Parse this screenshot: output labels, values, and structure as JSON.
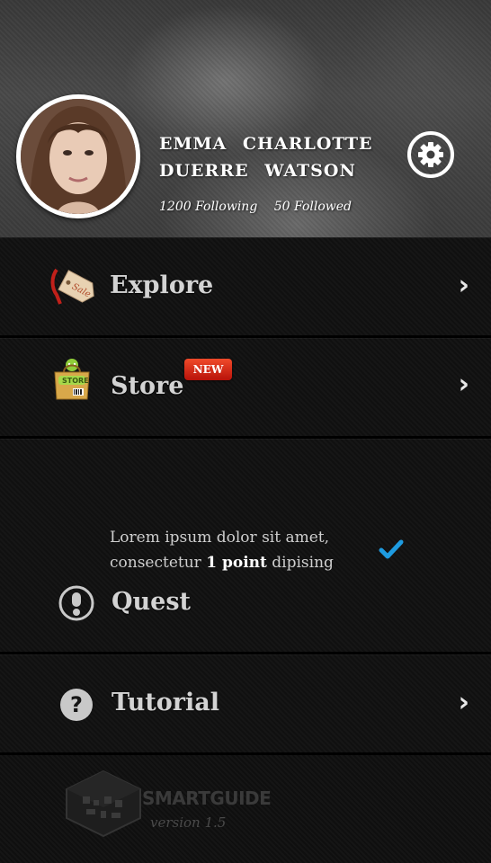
{
  "profile": {
    "name_line1": "EMMA   CHARLOTTE",
    "name_line2": "DUERRE   WATSON",
    "following": "1200 Following",
    "followed": "50 Followed"
  },
  "menu": {
    "explore": {
      "label": "Explore",
      "icon": "sale-tag-icon"
    },
    "store": {
      "label": "Store",
      "badge": "NEW",
      "icon": "store-bag-icon"
    },
    "quest": {
      "label": "Quest",
      "desc_line1": "Lorem ipsum dolor sit amet,",
      "desc_line2_prefix": "consectetur ",
      "desc_line2_bold": "1 point",
      "desc_line2_suffix": " dipising",
      "icon": "exclamation-icon"
    },
    "tutorial": {
      "label": "Tutorial",
      "icon": "question-icon"
    }
  },
  "footer": {
    "brand": "SMARTGUIDE",
    "version": "version 1.5"
  },
  "colors": {
    "badge": "#d42a14",
    "check": "#1e9be0"
  }
}
